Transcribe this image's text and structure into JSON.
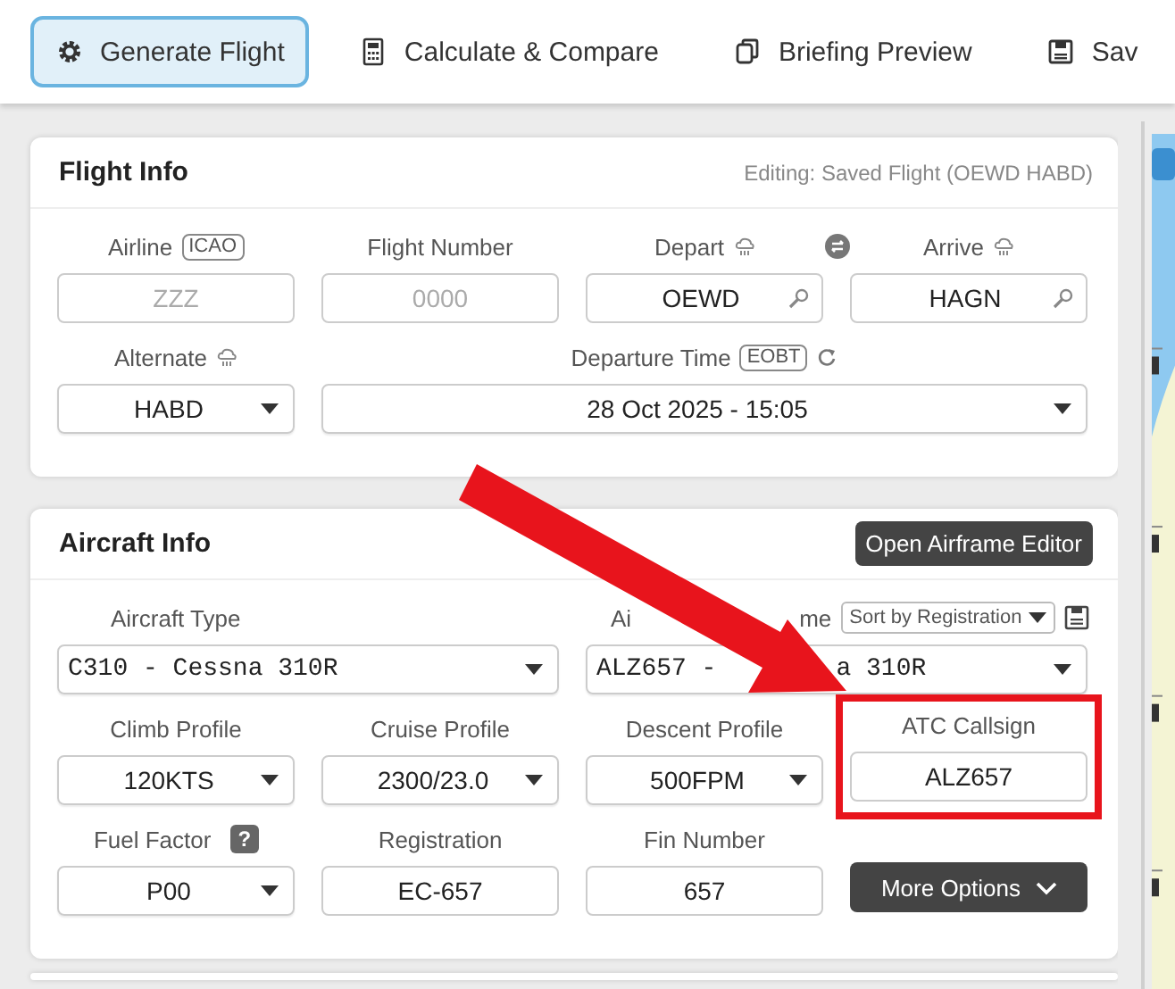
{
  "toolbar": [
    {
      "label": "Generate Flight",
      "selected": true
    },
    {
      "label": "Calculate & Compare",
      "selected": false
    },
    {
      "label": "Briefing Preview",
      "selected": false
    },
    {
      "label": "Sav",
      "selected": false
    }
  ],
  "cards": [
    {
      "title": "Flight Info",
      "note": "Editing: Saved Flight (OEWD HABD)",
      "fields": [
        {
          "kind": "text",
          "label": "Airline",
          "badge": "ICAO",
          "placeholder": "ZZZ"
        },
        {
          "kind": "text",
          "label": "Flight Number",
          "placeholder": "0000"
        },
        {
          "kind": "search",
          "label": "Depart",
          "weather": true,
          "swap": true,
          "value": "OEWD"
        },
        {
          "kind": "search",
          "label": "Arrive",
          "weather": true,
          "value": "HAGN"
        },
        {
          "kind": "select",
          "label": "Alternate",
          "weather": true,
          "value": "HABD"
        },
        {
          "kind": "datetime",
          "label": "Departure Time",
          "badge": "EOBT",
          "refresh": true,
          "value": "28 Oct 2025 - 15:05"
        }
      ]
    },
    {
      "title": "Aircraft Info",
      "action": "Open Airframe Editor",
      "fields": [
        {
          "kind": "mono-select",
          "label": "Aircraft Type",
          "value": "C310 - Cessna 310R"
        },
        {
          "kind": "mono-select",
          "label": "Ai",
          "label_tail": "me",
          "sort": "Sort by Registration",
          "save": true,
          "value": "ALZ657 -",
          "value_tail": "a 310R"
        },
        {
          "kind": "select",
          "label": "Climb Profile",
          "value": "120KTS"
        },
        {
          "kind": "select",
          "label": "Cruise Profile",
          "value": "2300/23.0"
        },
        {
          "kind": "select",
          "label": "Descent Profile",
          "value": "500FPM"
        },
        {
          "kind": "text",
          "label": "ATC Callsign",
          "value": "ALZ657",
          "highlighted": true
        },
        {
          "kind": "select",
          "label": "Fuel Factor",
          "help": "?",
          "value": "P00"
        },
        {
          "kind": "text",
          "label": "Registration",
          "value": "EC-657"
        },
        {
          "kind": "text",
          "label": "Fin Number",
          "value": "657"
        },
        {
          "kind": "button",
          "label": "More Options"
        }
      ]
    }
  ]
}
